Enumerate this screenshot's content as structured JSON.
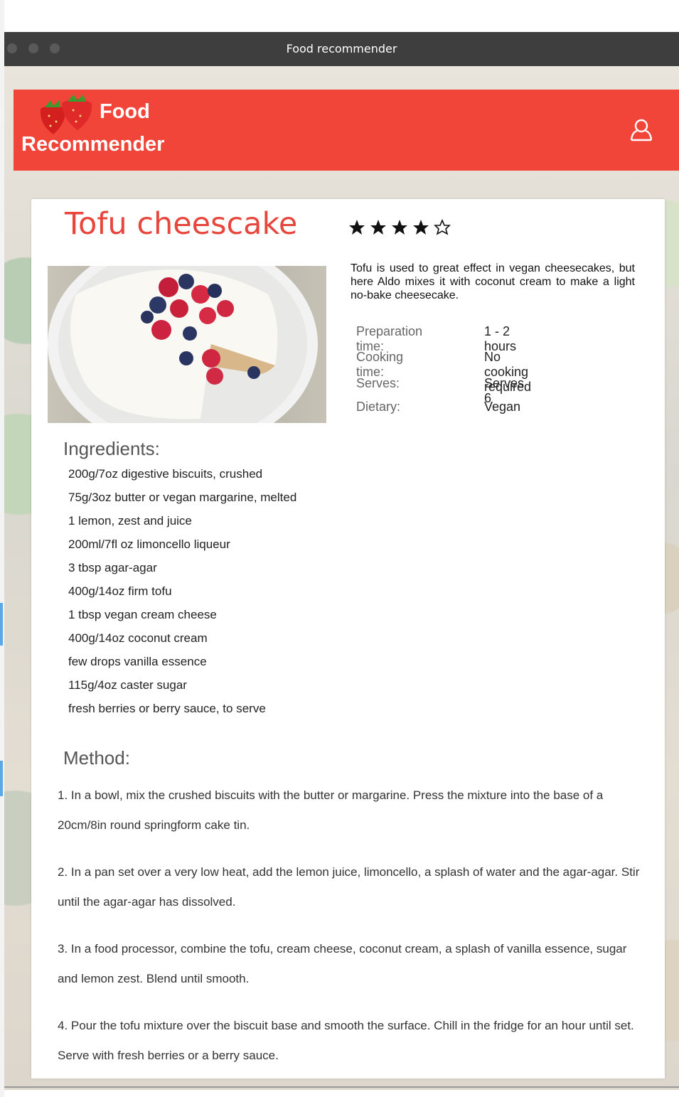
{
  "window": {
    "title": "Food recommender"
  },
  "header": {
    "logo_line1": "Food",
    "logo_line2": "Recommender",
    "brand_color": "#f2453a",
    "user_icon": "user-icon"
  },
  "recipe": {
    "title": "Tofu cheescake",
    "rating": 4,
    "rating_max": 5,
    "image_alt": "cheesecake-with-berries",
    "description": "Tofu is used to great effect in vegan cheesecakes, but here Aldo mixes it with coconut cream to make a light no-bake cheesecake.",
    "info": [
      {
        "label": "Preparation time:",
        "value": "1 - 2 hours"
      },
      {
        "label": "Cooking time:",
        "value": "No cooking required"
      },
      {
        "label": "Serves:",
        "value": "Serves 6"
      },
      {
        "label": "Dietary:",
        "value": "Vegan"
      }
    ],
    "ingredients_heading": "Ingredients:",
    "ingredients": [
      "200g/7oz digestive biscuits, crushed",
      "75g/3oz butter or vegan margarine, melted",
      "1 lemon, zest and juice",
      "200ml/7fl oz limoncello liqueur",
      "3 tbsp agar-agar",
      "400g/14oz firm tofu",
      "1 tbsp vegan cream cheese",
      "400g/14oz coconut cream",
      "few drops vanilla essence",
      "115g/4oz caster sugar",
      "fresh berries or berry sauce, to serve"
    ],
    "method_heading": "Method:",
    "method": [
      "1. In a bowl, mix the crushed biscuits with the butter or margarine. Press the mixture into the base of a 20cm/8in round springform cake tin.",
      "2. In a pan set over a very low heat, add the lemon juice, limoncello, a splash of water and the agar-agar. Stir until the agar-agar has dissolved.",
      "3. In a food processor, combine the tofu, cream cheese, coconut cream, a splash of vanilla essence, sugar and lemon zest. Blend until smooth.",
      "4. Pour the tofu mixture over the biscuit base and smooth the surface. Chill in the fridge for an hour until set. Serve with fresh berries or a berry sauce."
    ]
  }
}
